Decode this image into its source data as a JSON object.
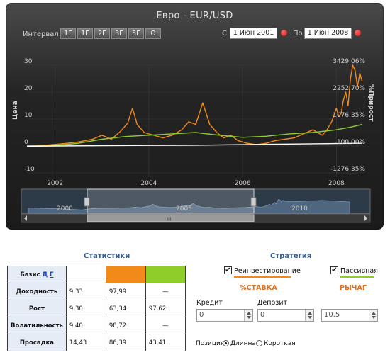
{
  "title": "Евро - EUR/USD",
  "toolbar": {
    "interval_label": "Интервал",
    "interval_buttons": [
      "1Г",
      "1Г",
      "2Г",
      "3Г",
      "5Г",
      "Ω"
    ],
    "from_label": "С",
    "from_value": "1 Июн 2001",
    "to_label": "По",
    "to_value": "1 Июн 2008"
  },
  "chart_data": {
    "type": "line",
    "ylabel_left": "Цена",
    "ylabel_right": "%Прирост",
    "y_ticks_left": [
      "30",
      "20",
      "10",
      "0",
      "-10"
    ],
    "y_ticks_right": [
      "3429.06%",
      "2252.70%",
      "1076.35%",
      "-100.00%",
      "-1276.35%"
    ],
    "x_ticks": [
      "2002",
      "2004",
      "2006",
      "2008"
    ],
    "x_range": [
      2001.4,
      2008.6
    ],
    "y_range": [
      -10,
      30
    ],
    "series": [
      {
        "color": "#f28a1a",
        "x": [
          2001.4,
          2001.8,
          2002.2,
          2002.5,
          2002.8,
          2003.0,
          2003.2,
          2003.4,
          2003.55,
          2003.65,
          2003.75,
          2003.9,
          2004.1,
          2004.3,
          2004.5,
          2004.7,
          2004.85,
          2005.0,
          2005.15,
          2005.3,
          2005.45,
          2005.6,
          2005.75,
          2005.9,
          2006.1,
          2006.3,
          2006.5,
          2006.7,
          2006.9,
          2007.1,
          2007.3,
          2007.5,
          2007.7,
          2007.8,
          2007.9,
          2008.0,
          2008.05,
          2008.1,
          2008.15,
          2008.2,
          2008.25,
          2008.3,
          2008.35,
          2008.4,
          2008.45,
          2008.5,
          2008.55
        ],
        "y": [
          0,
          0.3,
          0.9,
          1.5,
          2.5,
          4,
          2.5,
          5.5,
          8.5,
          14,
          8,
          5,
          4,
          3,
          4,
          6,
          9,
          8,
          16,
          8,
          5,
          3,
          4,
          2,
          1,
          0.5,
          1,
          2,
          2.5,
          3,
          4.5,
          6,
          4,
          6,
          9,
          14,
          11,
          12,
          17,
          20,
          15,
          25,
          30,
          28,
          22,
          27,
          24
        ]
      },
      {
        "color": "#8fce2a",
        "x": [
          2001.4,
          2002.0,
          2002.5,
          2003.0,
          2003.5,
          2004.0,
          2004.5,
          2005.0,
          2005.5,
          2006.0,
          2006.5,
          2007.0,
          2007.5,
          2008.0,
          2008.3,
          2008.55
        ],
        "y": [
          0,
          0.2,
          1,
          2.5,
          3.5,
          4,
          4.5,
          5,
          4,
          3.2,
          3.6,
          4.5,
          5,
          6,
          7,
          8
        ]
      },
      {
        "color": "#ffffff",
        "x": [
          2001.4,
          2002.0,
          2003.0,
          2004.0,
          2005.0,
          2006.0,
          2007.0,
          2008.0,
          2008.55
        ],
        "y": [
          -0.1,
          0,
          0.1,
          0.2,
          0.3,
          0.5,
          0.7,
          0.9,
          1.0
        ]
      }
    ]
  },
  "navigator": {
    "labels": [
      "2000",
      "2005",
      "2010"
    ],
    "grip": "III"
  },
  "stats": {
    "title": "Статистики",
    "basis_label": "Базис",
    "basis_links": [
      "Д",
      "Г"
    ],
    "swatch_colors": [
      "#ffffff",
      "#f28a1a",
      "#8fce2a"
    ],
    "rows": [
      {
        "label": "Доходность",
        "values": [
          "9,33",
          "97,99",
          "—"
        ]
      },
      {
        "label": "Рост",
        "values": [
          "9,30",
          "63,34",
          "97,62"
        ]
      },
      {
        "label": "Волатильность",
        "values": [
          "9,40",
          "98,72",
          "—"
        ]
      },
      {
        "label": "Просадка",
        "values": [
          "14,43",
          "86,39",
          "43,41"
        ]
      }
    ]
  },
  "strategy": {
    "title": "Стратегия",
    "reinvest_label": "Реинвестирование",
    "passive_label": "Пассивная",
    "rate_head": "%СТАВКА",
    "leverage_head": "РЫЧАГ",
    "credit_label": "Кредит",
    "credit_value": "0",
    "deposit_label": "Депозит",
    "deposit_value": "0",
    "leverage_value": "10.5",
    "position_label": "Позиция:",
    "long_label": "Длинная",
    "short_label": "Короткая"
  }
}
